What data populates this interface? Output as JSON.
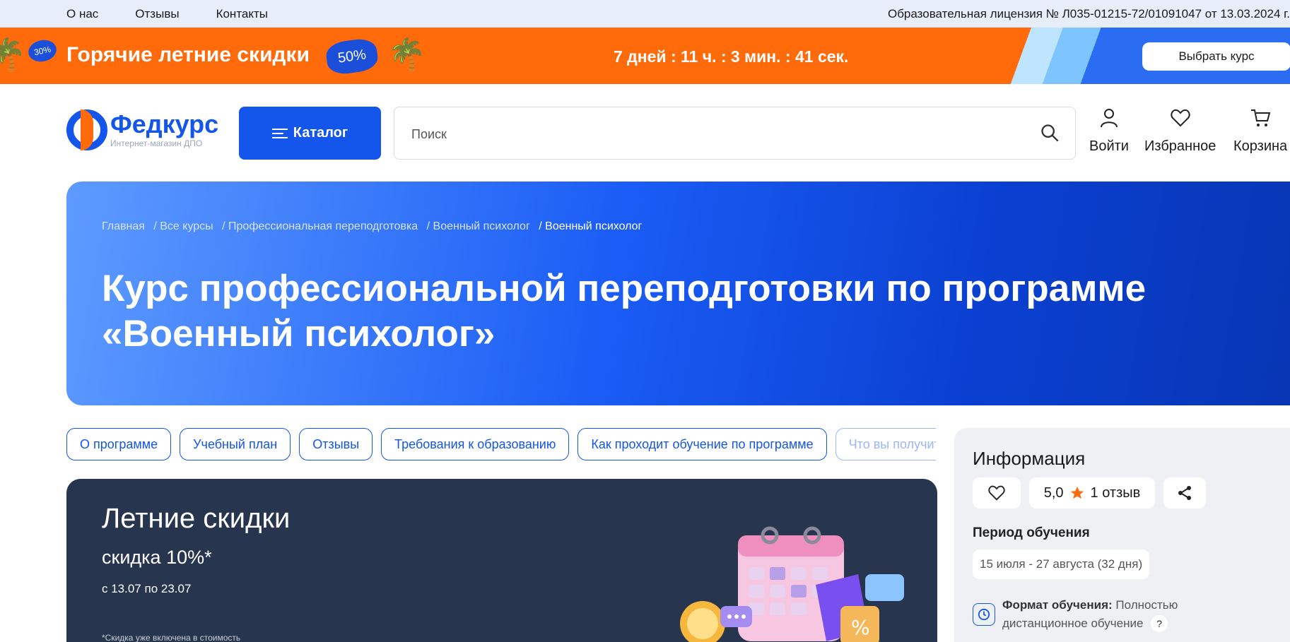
{
  "topbar": {
    "nav": [
      "О нас",
      "Отзывы",
      "Контакты"
    ],
    "license": "Образовательная лицензия № Л035-01215-72/01091047 от 13.03.2024 г."
  },
  "promo": {
    "badge_small": "30%",
    "title": "Горячие летние скидки",
    "badge_big": "50%",
    "timer": "7 дней : 11 ч. : 3 мин. : 41 сек.",
    "cta": "Выбрать курс"
  },
  "header": {
    "logo_brand_a": "Фед",
    "logo_brand_b": "курс",
    "logo_sub": "Интернет-магазин ДПО",
    "catalog": "Каталог",
    "search_placeholder": "Поиск",
    "login": "Войти",
    "favorites": "Избранное",
    "cart": "Корзина"
  },
  "hero": {
    "breadcrumbs": [
      "Главная",
      "/ Все курсы",
      "/ Профессиональная переподготовка",
      "/ Военный психолог",
      "/ Военный психолог"
    ],
    "title": "Курс профессиональной переподготовки по программе «Военный психолог»"
  },
  "tabs": [
    "О программе",
    "Учебный план",
    "Отзывы",
    "Требования к образованию",
    "Как проходит обучение по программе",
    "Что вы получите"
  ],
  "summer": {
    "heading": "Летние скидки",
    "discount": "скидка 10%*",
    "dates": "с 13.07 по 23.07",
    "note": "*Скидка уже включена в стоимость"
  },
  "info": {
    "heading": "Информация",
    "rating": "5,0",
    "reviews": "1 отзыв",
    "period_label": "Период обучения",
    "period_value": "15 июля - 27 августа (32 дня)",
    "format_label": "Формат обучения:",
    "format_value": "Полностью дистанционное обучение",
    "help": "?"
  },
  "colors": {
    "brand_blue": "#1455ec",
    "brand_orange": "#ff6a0a",
    "dark_card": "#28354f",
    "star": "#ff6a0a"
  }
}
